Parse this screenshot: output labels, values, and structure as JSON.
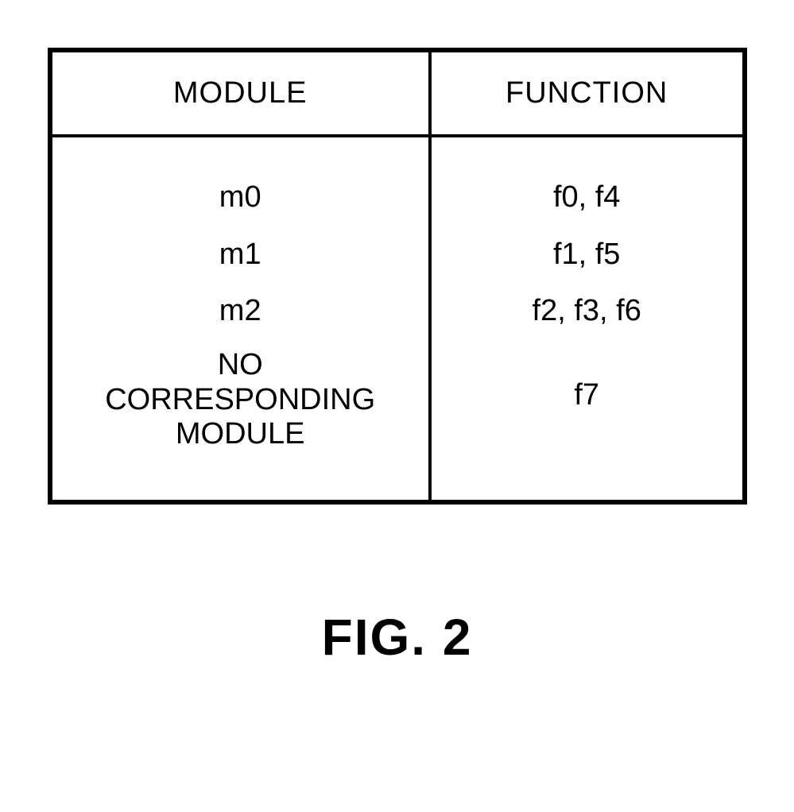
{
  "table": {
    "headers": {
      "module": "MODULE",
      "function": "FUNCTION"
    },
    "rows": [
      {
        "module": "m0",
        "function": "f0, f4"
      },
      {
        "module": "m1",
        "function": "f1, f5"
      },
      {
        "module": "m2",
        "function": "f2, f3, f6"
      },
      {
        "module": "NO\nCORRESPONDING\nMODULE",
        "function": "f7"
      }
    ]
  },
  "caption": "FIG. 2"
}
